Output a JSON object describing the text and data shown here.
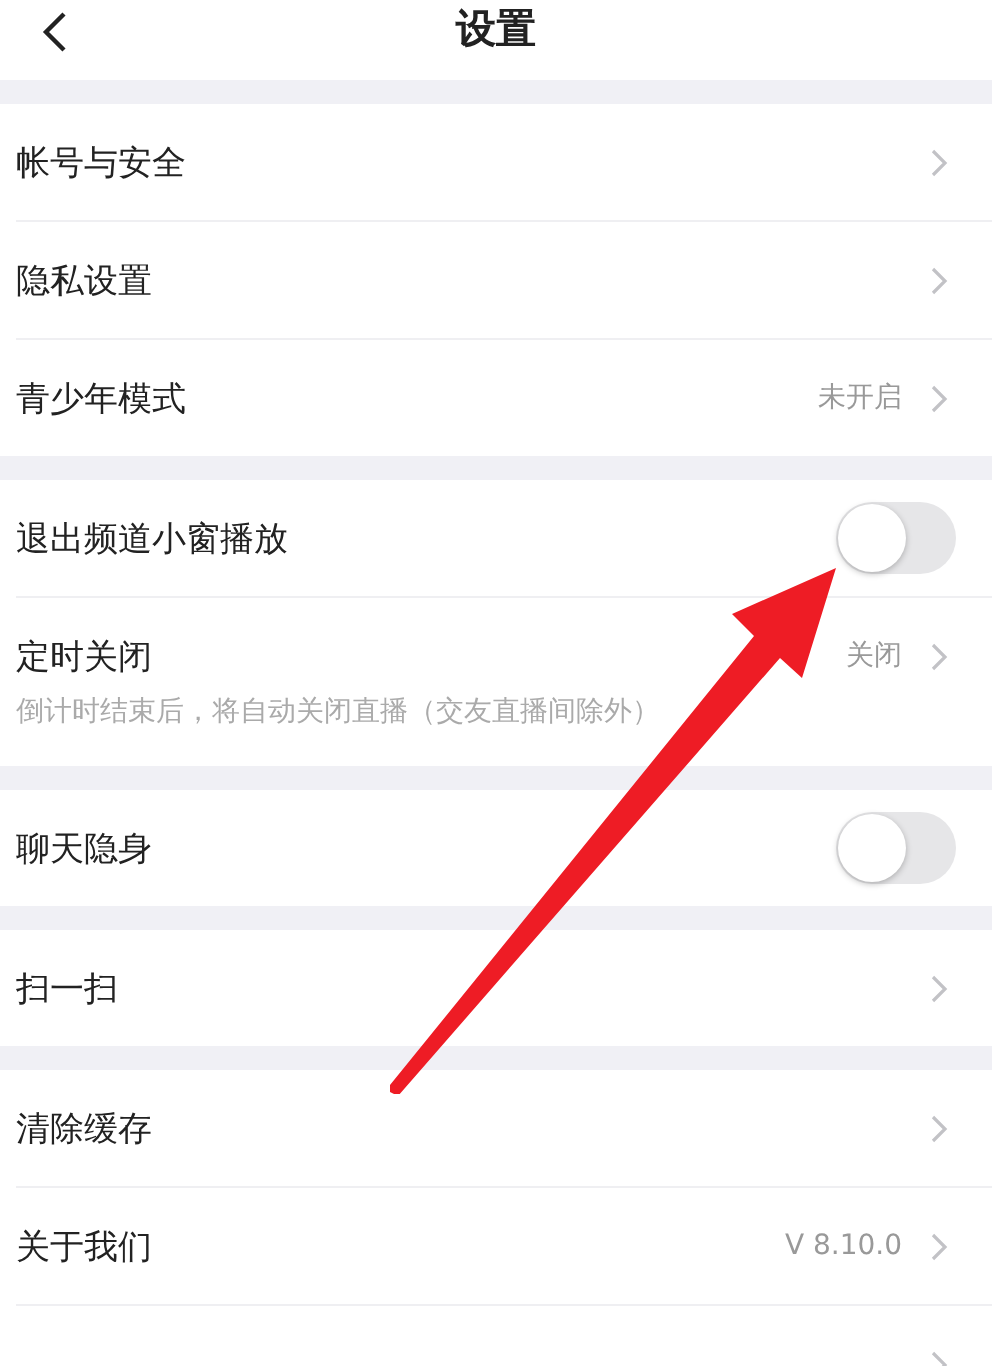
{
  "header": {
    "title": "设置"
  },
  "sections": [
    {
      "rows": [
        {
          "kind": "link",
          "label": "帐号与安全"
        },
        {
          "kind": "link",
          "label": "隐私设置"
        },
        {
          "kind": "link",
          "label": "青少年模式",
          "value": "未开启"
        }
      ]
    },
    {
      "rows": [
        {
          "kind": "toggle",
          "label": "退出频道小窗播放",
          "on": false
        },
        {
          "kind": "link",
          "label": "定时关闭",
          "value": "关闭",
          "note": "倒计时结束后，将自动关闭直播（交友直播间除外）"
        }
      ]
    },
    {
      "rows": [
        {
          "kind": "toggle",
          "label": "聊天隐身",
          "on": false
        }
      ]
    },
    {
      "rows": [
        {
          "kind": "link",
          "label": "扫一扫"
        }
      ]
    },
    {
      "rows": [
        {
          "kind": "link",
          "label": "清除缓存"
        },
        {
          "kind": "link",
          "label": "关于我们",
          "value": "V 8.10.0"
        },
        {
          "kind": "link"
        }
      ]
    }
  ]
}
